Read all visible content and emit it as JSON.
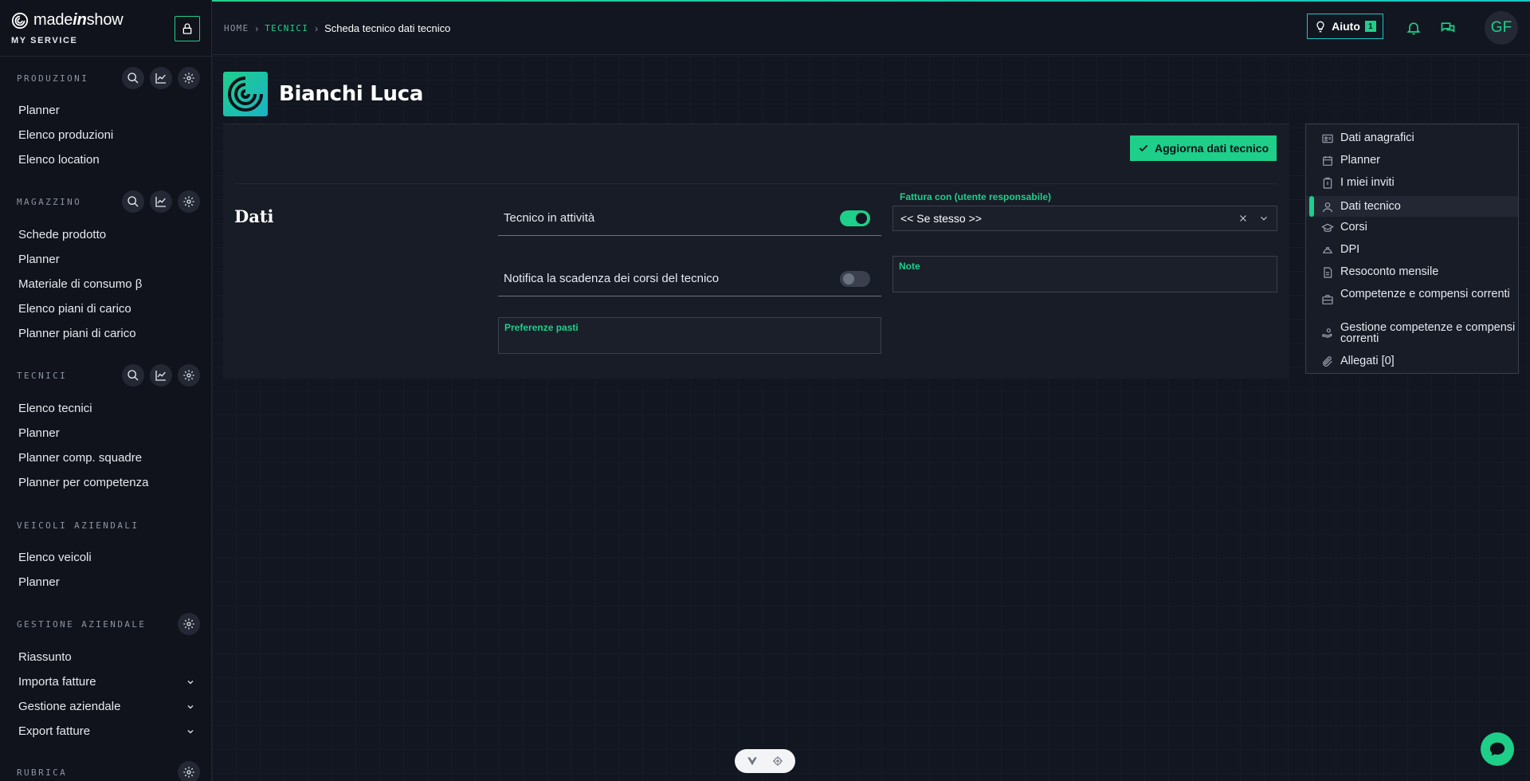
{
  "brand": {
    "name_part1": "made",
    "name_part2": "in",
    "name_part3": "show",
    "subtitle": "MY SERVICE"
  },
  "sidebar": {
    "sections": [
      {
        "title": "PRODUZIONI",
        "items": [
          "Planner",
          "Elenco produzioni",
          "Elenco location"
        ]
      },
      {
        "title": "MAGAZZINO",
        "items": [
          "Schede prodotto",
          "Planner",
          "Materiale di consumo β",
          "Elenco piani di carico",
          "Planner piani di carico"
        ]
      },
      {
        "title": "TECNICI",
        "items": [
          "Elenco tecnici",
          "Planner",
          "Planner comp. squadre",
          "Planner per competenza"
        ]
      },
      {
        "title": "VEICOLI AZIENDALI",
        "items": [
          "Elenco veicoli",
          "Planner"
        ]
      },
      {
        "title": "GESTIONE AZIENDALE",
        "items": [
          "Riassunto",
          "Importa fatture",
          "Gestione aziendale",
          "Export fatture"
        ]
      },
      {
        "title": "RUBRICA",
        "items": []
      }
    ]
  },
  "breadcrumb": {
    "home": "HOME",
    "section": "TECNICI",
    "current": "Scheda tecnico dati tecnico"
  },
  "topbar": {
    "help_label": "Aiuto",
    "help_badge": "1",
    "avatar_initials": "GF"
  },
  "page": {
    "title": "Bianchi Luca",
    "section_label": "Dati",
    "update_button": "Aggiorna dati tecnico"
  },
  "form": {
    "tecnico_attivo": {
      "label": "Tecnico in attività",
      "value": true
    },
    "notifica_corsi": {
      "label": "Notifica la scadenza dei corsi del tecnico",
      "value": false
    },
    "fattura_con": {
      "label": "Fattura con (utente responsabile)",
      "value": "<< Se stesso >>"
    },
    "note": {
      "label": "Note",
      "value": ""
    },
    "preferenze_pasti": {
      "label": "Preferenze pasti",
      "value": ""
    }
  },
  "side_menu": {
    "items": [
      {
        "label": "Dati anagrafici",
        "icon": "id-card-icon"
      },
      {
        "label": "Planner",
        "icon": "calendar-icon"
      },
      {
        "label": "I miei inviti",
        "icon": "invite-icon"
      },
      {
        "label": "Dati tecnico",
        "icon": "person-icon",
        "active": true
      },
      {
        "label": "Corsi",
        "icon": "graduation-cap-icon"
      },
      {
        "label": "DPI",
        "icon": "helmet-icon"
      },
      {
        "label": "Resoconto mensile",
        "icon": "report-icon"
      },
      {
        "label": "Competenze e compensi correnti",
        "icon": "briefcase-icon"
      },
      {
        "label": "Gestione competenze e compensi correnti",
        "icon": "hand-coins-icon"
      },
      {
        "label": "Allegati [0]",
        "icon": "paperclip-icon"
      }
    ]
  },
  "colors": {
    "accent": "#1ecf8a",
    "accent_secondary": "#19c7c7",
    "background": "#121620",
    "sidebar": "#10131b"
  }
}
